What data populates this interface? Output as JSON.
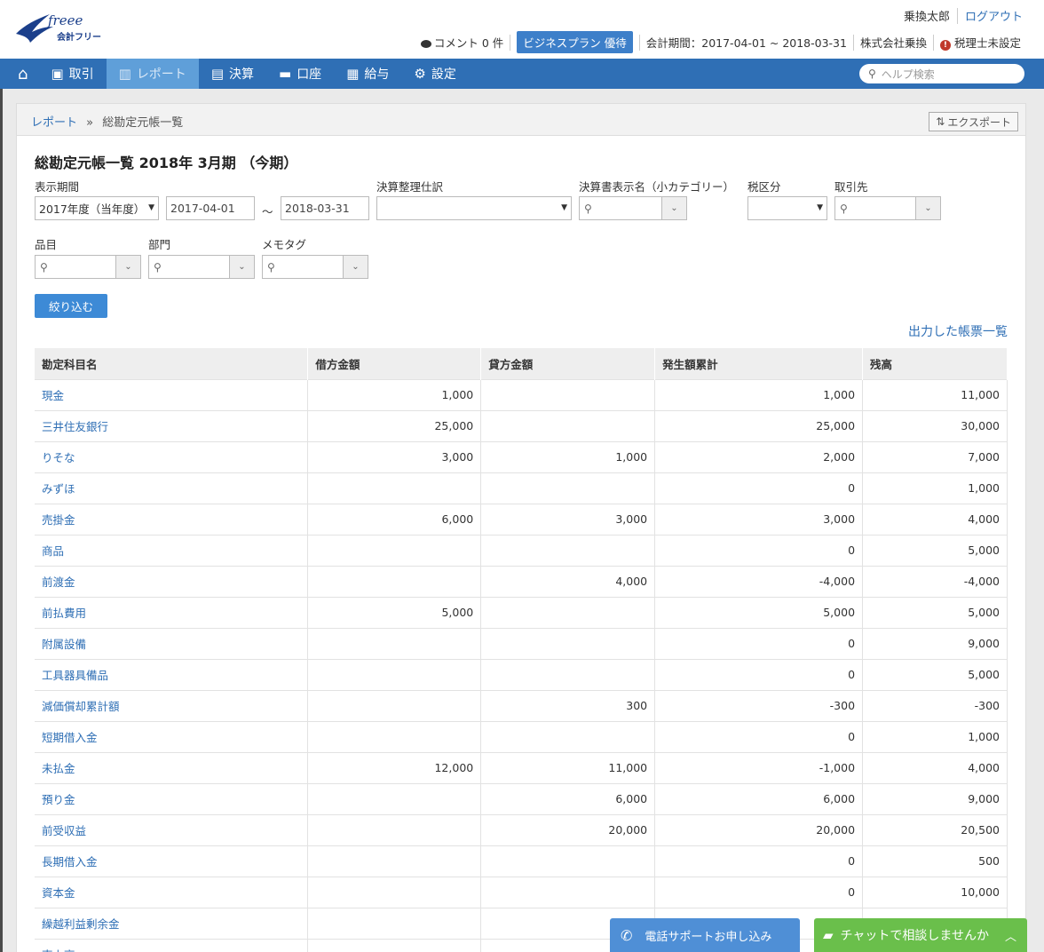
{
  "header": {
    "logo_script": "freee",
    "logo_text": "会計フリー",
    "user_name": "乗換太郎",
    "logout": "ログアウト",
    "comments": "コメント 0 件",
    "plan": "ビジネスプラン 優待",
    "period": "会計期間：2017-04-01 ~ 2018-03-31",
    "company": "株式会社乗換",
    "tax_accountant": "税理士未設定"
  },
  "nav": {
    "items": [
      {
        "label": "取引",
        "icon": "inbox-icon"
      },
      {
        "label": "レポート",
        "icon": "chart-icon"
      },
      {
        "label": "決算",
        "icon": "books-icon"
      },
      {
        "label": "口座",
        "icon": "card-icon"
      },
      {
        "label": "給与",
        "icon": "calendar-icon"
      },
      {
        "label": "設定",
        "icon": "gear-icon"
      }
    ],
    "search_placeholder": "ヘルプ検索"
  },
  "breadcrumb": {
    "parent": "レポート",
    "separator": "»",
    "current": "総勘定元帳一覧"
  },
  "export_label": "エクスポート",
  "page_title": "総勘定元帳一覧 2018年 3月期 （今期）",
  "filters": {
    "period_label": "表示期間",
    "period_select": "2017年度（当年度）",
    "date_from": "2017-04-01",
    "tilde": "～",
    "date_to": "2018-03-31",
    "closing_label": "決算整理仕訳",
    "category_label": "決算書表示名（小カテゴリー）",
    "tax_label": "税区分",
    "partner_label": "取引先",
    "item_label": "品目",
    "dept_label": "部門",
    "memo_label": "メモタグ",
    "filter_button": "絞り込む"
  },
  "output_list_link": "出力した帳票一覧",
  "table": {
    "headers": [
      "勘定科目名",
      "借方金額",
      "貸方金額",
      "発生額累計",
      "残高"
    ],
    "rows": [
      [
        "現金",
        "1,000",
        "",
        "1,000",
        "11,000"
      ],
      [
        "三井住友銀行",
        "25,000",
        "",
        "25,000",
        "30,000"
      ],
      [
        "りそな",
        "3,000",
        "1,000",
        "2,000",
        "7,000"
      ],
      [
        "みずほ",
        "",
        "",
        "0",
        "1,000"
      ],
      [
        "売掛金",
        "6,000",
        "3,000",
        "3,000",
        "4,000"
      ],
      [
        "商品",
        "",
        "",
        "0",
        "5,000"
      ],
      [
        "前渡金",
        "",
        "4,000",
        "-4,000",
        "-4,000"
      ],
      [
        "前払費用",
        "5,000",
        "",
        "5,000",
        "5,000"
      ],
      [
        "附属設備",
        "",
        "",
        "0",
        "9,000"
      ],
      [
        "工具器具備品",
        "",
        "",
        "0",
        "5,000"
      ],
      [
        "減価償却累計額",
        "",
        "300",
        "-300",
        "-300"
      ],
      [
        "短期借入金",
        "",
        "",
        "0",
        "1,000"
      ],
      [
        "未払金",
        "12,000",
        "11,000",
        "-1,000",
        "4,000"
      ],
      [
        "預り金",
        "",
        "6,000",
        "6,000",
        "9,000"
      ],
      [
        "前受収益",
        "",
        "20,000",
        "20,000",
        "20,500"
      ],
      [
        "長期借入金",
        "",
        "",
        "0",
        "500"
      ],
      [
        "資本金",
        "",
        "",
        "0",
        "10,000"
      ],
      [
        "繰越利益剰余金",
        "",
        "",
        "",
        ""
      ],
      [
        "売上高",
        "",
        "",
        "",
        ""
      ]
    ]
  },
  "support_button": "電話サポートお申し込み",
  "chat_button": "チャットで相談しませんか"
}
